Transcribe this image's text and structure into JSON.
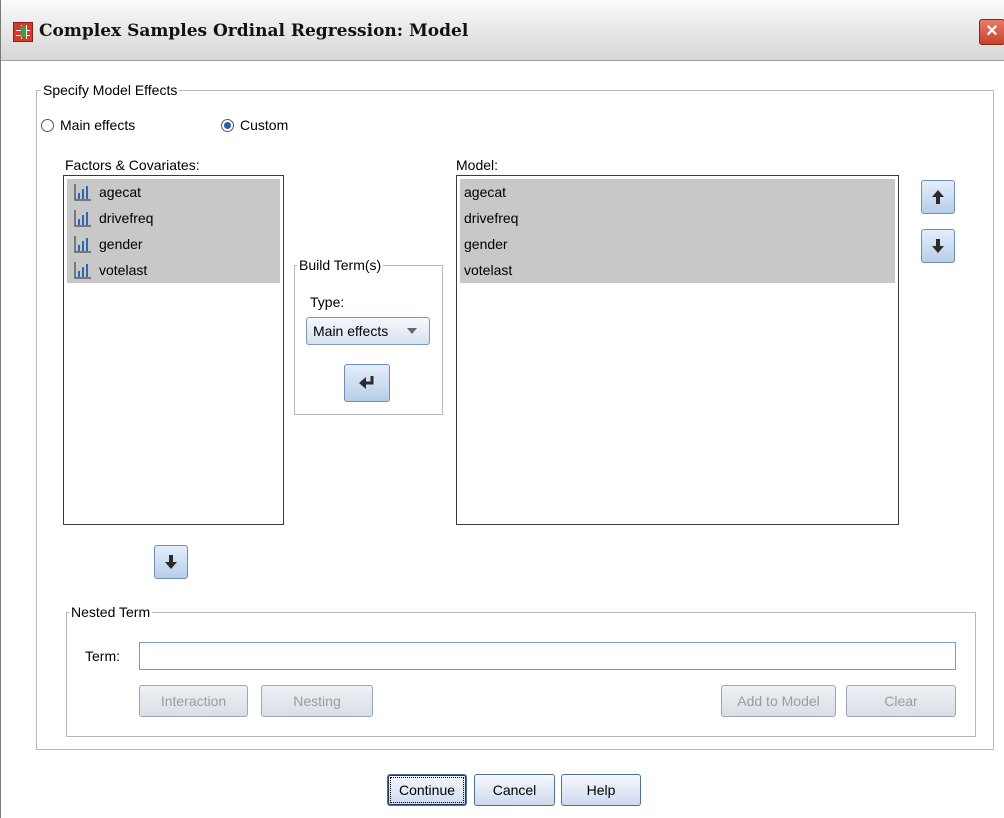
{
  "window": {
    "title": "Complex Samples Ordinal Regression: Model",
    "close_label": "×"
  },
  "specify": {
    "legend": "Specify Model Effects",
    "main_effects_label": "Main effects",
    "custom_label": "Custom",
    "selected": "Custom"
  },
  "factors": {
    "label": "Factors & Covariates:",
    "items": [
      "agecat",
      "drivefreq",
      "gender",
      "votelast"
    ]
  },
  "build": {
    "legend": "Build Term(s)",
    "type_label": "Type:",
    "type_value": "Main effects"
  },
  "model": {
    "label": "Model:",
    "items": [
      "agecat",
      "drivefreq",
      "gender",
      "votelast"
    ]
  },
  "nested": {
    "legend": "Nested Term",
    "term_label": "Term:",
    "term_value": "",
    "interaction_label": "Interaction",
    "nesting_label": "Nesting",
    "add_label": "Add to Model",
    "clear_label": "Clear"
  },
  "footer": {
    "continue_label": "Continue",
    "cancel_label": "Cancel",
    "help_label": "Help"
  },
  "icons": {
    "variable": "ordinal-variable-icon",
    "up": "arrow-up-icon",
    "down": "arrow-down-icon",
    "build": "arrow-return-left-icon"
  },
  "colors": {
    "selection": "#c8c8c8",
    "arrow_button": "#b8cde9",
    "close_button": "#c9422b"
  }
}
